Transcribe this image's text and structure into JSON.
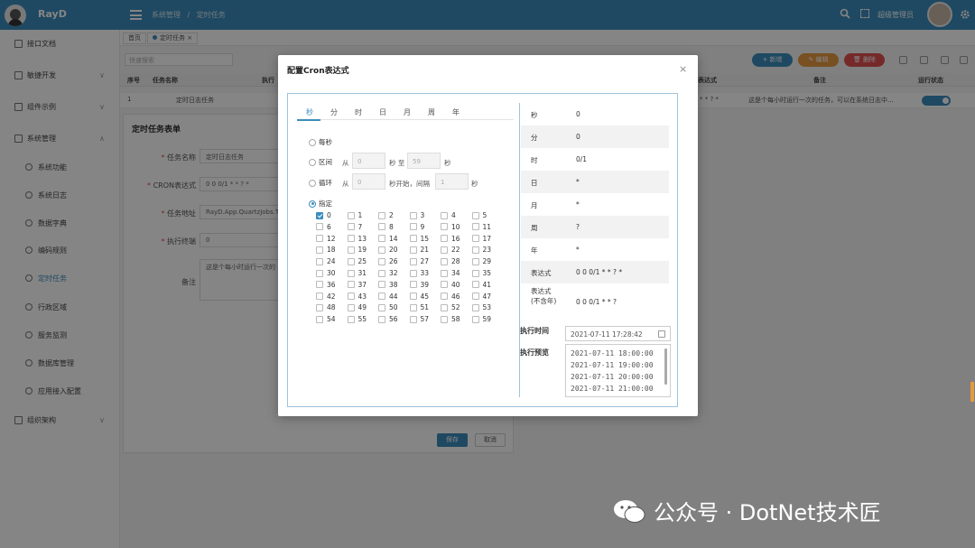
{
  "header": {
    "app_title": "RayD",
    "breadcrumb": [
      "系统管理",
      "/",
      "定时任务"
    ],
    "user_name": "超级管理员"
  },
  "sidebar": {
    "items": [
      {
        "label": "接口文档"
      },
      {
        "label": "敏捷开发",
        "arrow": "∨"
      },
      {
        "label": "组件示例",
        "arrow": "∨"
      },
      {
        "label": "系统管理",
        "arrow": "∧"
      },
      {
        "label": "系统功能"
      },
      {
        "label": "系统日志"
      },
      {
        "label": "数据字典"
      },
      {
        "label": "编码规则"
      },
      {
        "label": "定时任务"
      },
      {
        "label": "行政区域"
      },
      {
        "label": "服务监测"
      },
      {
        "label": "数据库管理"
      },
      {
        "label": "应用接入配置"
      },
      {
        "label": "组织架构",
        "arrow": "∨"
      }
    ]
  },
  "tabs": {
    "home": "首页",
    "current": "定时任务",
    "close": "×"
  },
  "toolbar": {
    "search_placeholder": "快速搜索",
    "add": "+ 新增",
    "edit": "✎ 编辑",
    "delete": "🗑 删除"
  },
  "grid": {
    "headers": [
      "序号",
      "任务名称",
      "执行",
      "表达式",
      "备注",
      "运行状态"
    ],
    "row": [
      "1",
      "定时日志任务",
      "",
      "* * ? *",
      "这是个每小时运行一次的任务，可以在系统日志中..."
    ]
  },
  "form": {
    "title": "定时任务表单",
    "fields": [
      {
        "label": "任务名称",
        "required": true,
        "value": "定时日志任务"
      },
      {
        "label": "CRON表达式",
        "required": true,
        "value": "0 0 0/1 * * ? *"
      },
      {
        "label": "任务地址",
        "required": true,
        "value": "RayD.App.QuartzJobs.Te"
      },
      {
        "label": "执行终端",
        "required": true,
        "value": "0"
      },
      {
        "label": "备注",
        "required": false,
        "value": "这是个每小时运行一次的"
      }
    ],
    "save": "保存",
    "cancel": "取消"
  },
  "dialog": {
    "title": "配置Cron表达式",
    "close": "×",
    "tabs": [
      "秒",
      "分",
      "时",
      "日",
      "月",
      "周",
      "年"
    ],
    "options": {
      "every": "每秒",
      "range": "区间",
      "range_from": "从",
      "range_from_val": "0",
      "range_mid": "秒 至",
      "range_to_val": "59",
      "range_end": "秒",
      "loop": "循环",
      "loop_from": "从",
      "loop_from_val": "0",
      "loop_mid": "秒开始，间隔",
      "loop_step_val": "1",
      "loop_end": "秒",
      "specify": "指定"
    },
    "seconds": [
      "0",
      "1",
      "2",
      "3",
      "4",
      "5",
      "6",
      "7",
      "8",
      "9",
      "10",
      "11",
      "12",
      "13",
      "14",
      "15",
      "16",
      "17",
      "18",
      "19",
      "20",
      "21",
      "22",
      "23",
      "24",
      "25",
      "26",
      "27",
      "28",
      "29",
      "30",
      "31",
      "32",
      "33",
      "34",
      "35",
      "36",
      "37",
      "38",
      "39",
      "40",
      "41",
      "42",
      "43",
      "44",
      "45",
      "46",
      "47",
      "48",
      "49",
      "50",
      "51",
      "52",
      "53",
      "54",
      "55",
      "56",
      "57",
      "58",
      "59"
    ],
    "checked_seconds": [
      "0"
    ],
    "result": [
      {
        "k": "秒",
        "v": "0"
      },
      {
        "k": "分",
        "v": "0"
      },
      {
        "k": "时",
        "v": "0/1"
      },
      {
        "k": "日",
        "v": "*"
      },
      {
        "k": "月",
        "v": "*"
      },
      {
        "k": "周",
        "v": "?"
      },
      {
        "k": "年",
        "v": "*"
      },
      {
        "k": "表达式",
        "v": "0 0 0/1 * * ? *"
      },
      {
        "k": "表达式(不含年)",
        "v": "0 0 0/1 * * ?"
      }
    ],
    "exec_time_label": "执行时间",
    "exec_time_value": "2021-07-11 17:28:42",
    "preview_label": "执行预览",
    "preview": [
      "2021-07-11 18:00:00",
      "2021-07-11 19:00:00",
      "2021-07-11 20:00:00",
      "2021-07-11 21:00:00"
    ]
  },
  "watermark": "公众号 · DotNet技术匠",
  "colors": {
    "primary": "#3c8dbc",
    "add": "#3c8dbc",
    "edit": "#e69940",
    "delete": "#e15050"
  }
}
